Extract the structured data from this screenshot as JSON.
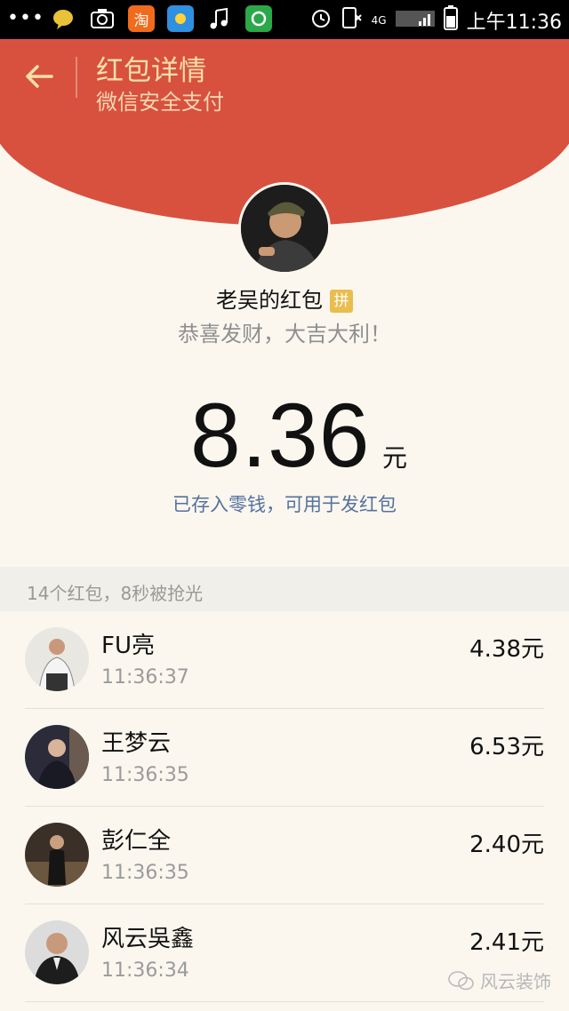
{
  "status_bar": {
    "dots": "•••",
    "time": "上午11:36",
    "network": "4G",
    "icons": [
      "chat-bubble-icon",
      "camera-icon",
      "taobao-icon",
      "weather-icon",
      "music-icon",
      "gift-icon",
      "alarm-icon",
      "mute-icon",
      "signal-icon",
      "battery-icon"
    ],
    "taobao_label": "淘"
  },
  "header": {
    "title": "红包详情",
    "subtitle": "微信安全支付",
    "bg_color": "#d8513f",
    "title_color": "#fbe0a8"
  },
  "sender": {
    "name": "老吴的红包",
    "badge": "拼",
    "blessing": "恭喜发财，大吉大利！"
  },
  "amount": {
    "value": "8.36",
    "unit": "元",
    "stored_note": "已存入零钱，可用于发红包"
  },
  "list": {
    "caption": "14个红包，8秒被抢光",
    "items": [
      {
        "name": "FU亮",
        "time": "11:36:37",
        "amount": "4.38元"
      },
      {
        "name": "王梦云",
        "time": "11:36:35",
        "amount": "6.53元"
      },
      {
        "name": "彭仁全",
        "time": "11:36:35",
        "amount": "2.40元"
      },
      {
        "name": "风云吳鑫",
        "time": "11:36:34",
        "amount": "2.41元"
      }
    ]
  },
  "watermark": "风云装饰"
}
